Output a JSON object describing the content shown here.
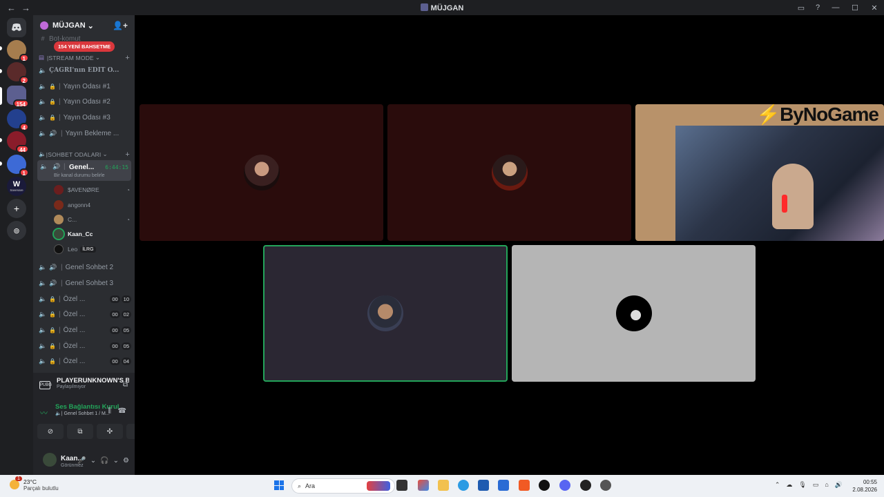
{
  "window": {
    "title": "MÜJGAN",
    "nav_back": "←",
    "nav_fwd": "→"
  },
  "server": {
    "name": "MÜJGAN",
    "mention_pill": "154 YENİ BAHSETME",
    "cut_row": "Bot-komut"
  },
  "guild_badges": [
    "1",
    "2",
    "154",
    "4",
    "44",
    "1"
  ],
  "guild_logo_label": "Savenare",
  "categories": {
    "stream": "STREAM MODE",
    "sohbet": "SOHBET ODALARI"
  },
  "stream_channels": [
    "ÇAGRI'nın EDIT O...",
    "Yayın Odası #1",
    "Yayın Odası #2",
    "Yayın Odası #3",
    "Yayın Bekleme ..."
  ],
  "active_channel": {
    "name": "Genel...",
    "time": "6:44:15",
    "status": "Bir kanal durumu belirle"
  },
  "voice_users": [
    {
      "name": "$AVENØRE"
    },
    {
      "name": "angonn4"
    },
    {
      "name": "C..."
    },
    {
      "name": "Kaan_Cc"
    },
    {
      "name": "Leo",
      "tag": "İLRG"
    }
  ],
  "more_channels": [
    "Genel Sohbet 2",
    "Genel Sohbet 3"
  ],
  "private_channels": [
    {
      "name": "Özel ...",
      "a": "00",
      "b": "10"
    },
    {
      "name": "Özel ...",
      "a": "00",
      "b": "02"
    },
    {
      "name": "Özel ...",
      "a": "00",
      "b": "05"
    },
    {
      "name": "Özel ...",
      "a": "00",
      "b": "05"
    },
    {
      "name": "Özel ...",
      "a": "00",
      "b": "04"
    }
  ],
  "activity": {
    "game": "PLAYERUNKNOWN'S B...",
    "sub": "Paylaşılmıyor",
    "icon": "PUBG"
  },
  "voice": {
    "status": "Ses Bağlantısı Kurul",
    "channel": "Genel Sohbet 1 / M..."
  },
  "me": {
    "name": "Kaan...",
    "status": "Görünmez"
  },
  "stream_overlay": {
    "brand": "ByNoGame"
  },
  "taskbar": {
    "temp": "23°C",
    "weather": "Parçalı bulutlu",
    "weather_badge": "1",
    "search": "Ara",
    "time": "00:55",
    "date": "2.08.2026"
  }
}
